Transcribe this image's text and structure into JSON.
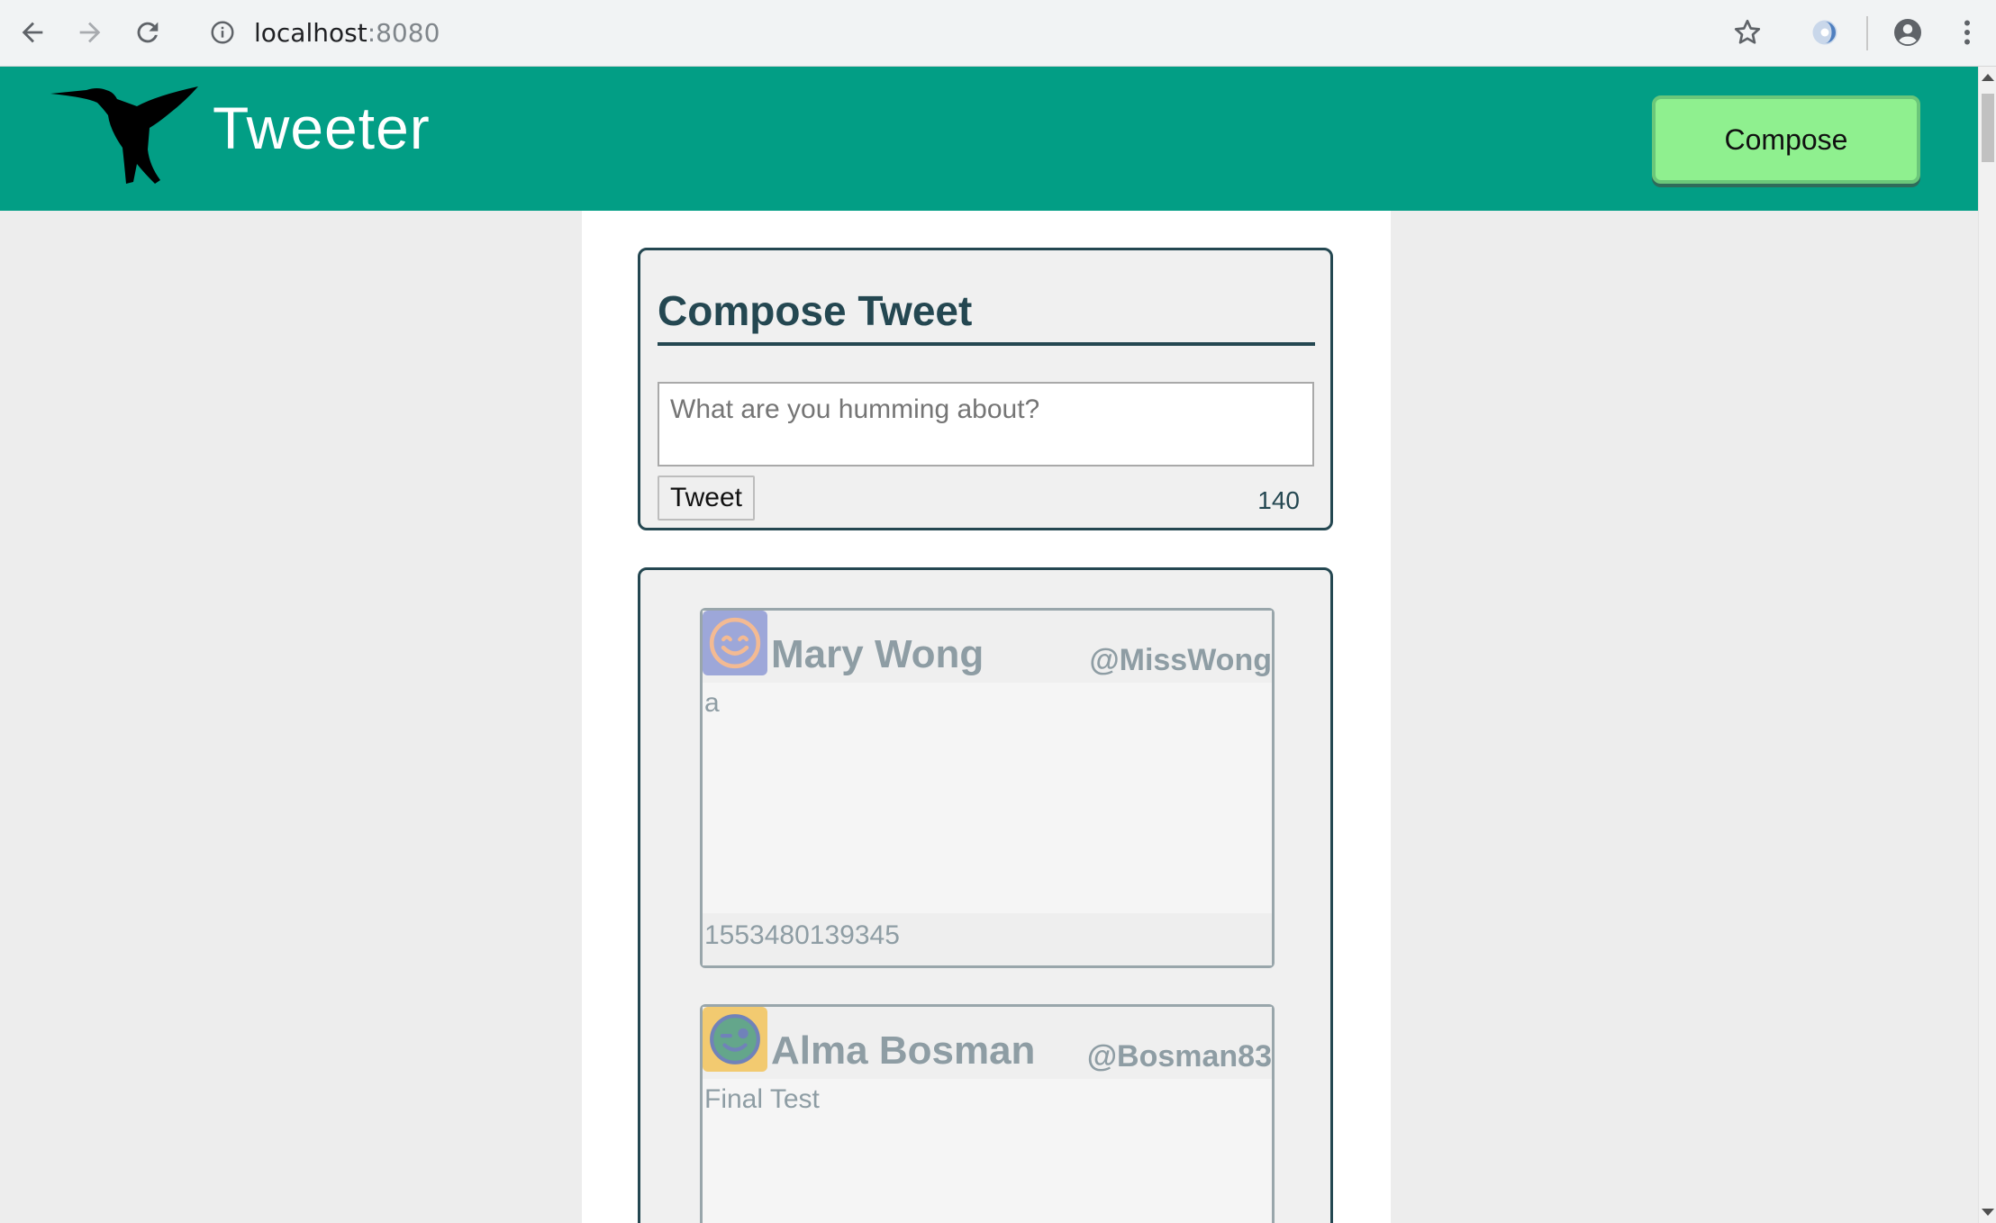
{
  "browser": {
    "url_host": "localhost",
    "url_port": ":8080",
    "icons": [
      "back-arrow-icon",
      "forward-arrow-icon",
      "reload-icon",
      "info-icon",
      "bookmark-star-icon",
      "extension-icon",
      "account-icon",
      "menu-dots-icon"
    ]
  },
  "header": {
    "brand": "Tweeter",
    "compose_label": "Compose",
    "bg_color": "#029e85"
  },
  "compose": {
    "title": "Compose Tweet",
    "placeholder": "What are you humming about?",
    "tweet_button": "Tweet",
    "counter": "140"
  },
  "tweets": [
    {
      "name": "Mary Wong",
      "handle": "@MissWong",
      "content": "a",
      "timestamp": "1553480139345",
      "avatar_icon": "smiling-face-icon",
      "avatar_bg": "#8f9bd6"
    },
    {
      "name": "Alma Bosman",
      "handle": "@Bosman83",
      "content": "Final Test",
      "avatar_icon": "winking-face-icon",
      "avatar_bg": "#f3c45a"
    }
  ]
}
